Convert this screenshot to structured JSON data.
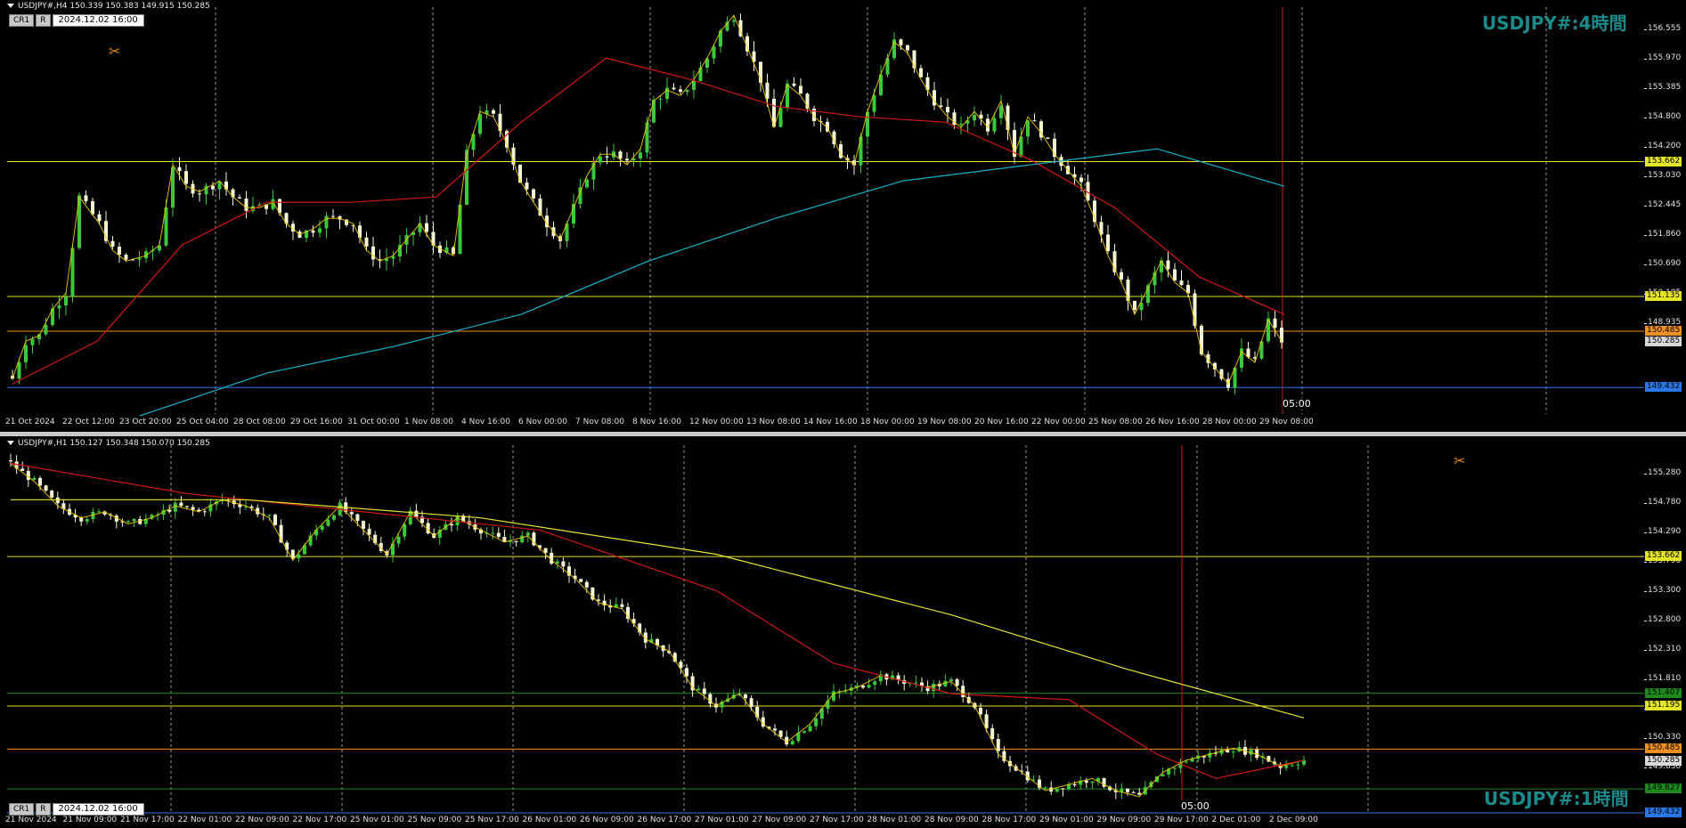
{
  "colors": {
    "background": "#000000",
    "bull_candle": "#3cc83c",
    "bear_candle": "#f5f5d2",
    "ma_red": "#d01818",
    "ma_cyan": "#14b4c8",
    "ma_yellow": "#e6e632",
    "zigzag": "#f0c800",
    "line_yellow": "#e6e628",
    "line_orange": "#f09020",
    "line_blue": "#2a78e6",
    "line_green": "#1e8a1e",
    "title": "#1c8a8a"
  },
  "top_pane": {
    "symbol_info": "USDJPY#,H4  150.339 150.383 149.915 150.285",
    "cr_label": "CR1",
    "r_label": "R",
    "datetime": "2024.12.02 16:00",
    "title": "USDJPY#:4時間",
    "marker_icon": "scissors-icon",
    "vline_label": "05:00",
    "price_labels": [
      "156.555",
      "155.970",
      "155.385",
      "154.800",
      "154.200",
      "153.030",
      "152.445",
      "151.860",
      "150.690",
      "150.105",
      "148.935"
    ],
    "price_tags": [
      {
        "text": "153.662",
        "bg": "#e6e628"
      },
      {
        "text": "151.135",
        "bg": "#e6e628"
      },
      {
        "text": "150.485",
        "bg": "#f09020"
      },
      {
        "text": "150.285",
        "bg": "#d8d8d8"
      },
      {
        "text": "149.432",
        "bg": "#2a78e6"
      }
    ],
    "time_labels": [
      "21 Oct 2024",
      "22 Oct 12:00",
      "23 Oct 20:00",
      "25 Oct 04:00",
      "28 Oct 08:00",
      "29 Oct 16:00",
      "31 Oct 00:00",
      "1 Nov 08:00",
      "4 Nov 16:00",
      "6 Nov 00:00",
      "7 Nov 08:00",
      "8 Nov 16:00",
      "12 Nov 00:00",
      "13 Nov 08:00",
      "14 Nov 16:00",
      "18 Nov 00:00",
      "19 Nov 08:00",
      "20 Nov 16:00",
      "22 Nov 00:00",
      "25 Nov 08:00",
      "26 Nov 16:00",
      "28 Nov 00:00",
      "29 Nov 08:00"
    ]
  },
  "bottom_pane": {
    "symbol_info": "USDJPY#,H1  150.127 150.348 150.070 150.285",
    "cr_label": "CR1",
    "r_label": "R",
    "datetime": "2024.12.02 16:00",
    "title": "USDJPY#:1時間",
    "marker_icon": "scissors-icon",
    "vline_label": "05:00",
    "price_labels": [
      "155.280",
      "154.780",
      "154.290",
      "153.790",
      "153.300",
      "152.800",
      "152.310",
      "151.810",
      "150.820",
      "150.330",
      "149.830"
    ],
    "price_tags": [
      {
        "text": "153.662",
        "bg": "#e6e628"
      },
      {
        "text": "151.407",
        "bg": "#1e8a1e"
      },
      {
        "text": "151.195",
        "bg": "#e6e628"
      },
      {
        "text": "150.485",
        "bg": "#f09020"
      },
      {
        "text": "150.285",
        "bg": "#d8d8d8"
      },
      {
        "text": "149.827",
        "bg": "#1e8a1e"
      },
      {
        "text": "149.432",
        "bg": "#2a78e6"
      }
    ],
    "time_labels": [
      "21 Nov 2024",
      "21 Nov 09:00",
      "21 Nov 17:00",
      "22 Nov 01:00",
      "22 Nov 09:00",
      "22 Nov 17:00",
      "25 Nov 01:00",
      "25 Nov 09:00",
      "25 Nov 17:00",
      "26 Nov 01:00",
      "26 Nov 09:00",
      "26 Nov 17:00",
      "27 Nov 01:00",
      "27 Nov 09:00",
      "27 Nov 17:00",
      "28 Nov 01:00",
      "28 Nov 09:00",
      "28 Nov 17:00",
      "29 Nov 01:00",
      "29 Nov 09:00",
      "29 Nov 17:00",
      "2 Dec 01:00",
      "2 Dec 09:00"
    ]
  },
  "chart_data": [
    {
      "type": "candlestick",
      "title": "USDJPY#:4時間",
      "timeframe": "H4",
      "ylim": [
        148.935,
        156.555
      ],
      "horizontal_lines": [
        153.662,
        151.135,
        150.485,
        149.432
      ],
      "close_price": 150.285,
      "close_path": [
        [
          0,
          149.6
        ],
        [
          2,
          150.3
        ],
        [
          4,
          150.4
        ],
        [
          6,
          150.9
        ],
        [
          8,
          151.2
        ],
        [
          10,
          153.0
        ],
        [
          13,
          152.5
        ],
        [
          15,
          152.0
        ],
        [
          17,
          151.8
        ],
        [
          20,
          151.9
        ],
        [
          22,
          152.1
        ],
        [
          24,
          153.6
        ],
        [
          26,
          153.2
        ],
        [
          28,
          153.1
        ],
        [
          31,
          153.3
        ],
        [
          33,
          153.0
        ],
        [
          35,
          152.8
        ],
        [
          37,
          152.8
        ],
        [
          39,
          152.9
        ],
        [
          41,
          152.5
        ],
        [
          43,
          152.3
        ],
        [
          45,
          152.4
        ],
        [
          47,
          152.6
        ],
        [
          49,
          152.6
        ],
        [
          51,
          152.5
        ],
        [
          53,
          152.0
        ],
        [
          55,
          151.8
        ],
        [
          57,
          151.9
        ],
        [
          59,
          152.2
        ],
        [
          61,
          152.5
        ],
        [
          63,
          152.1
        ],
        [
          66,
          151.9
        ],
        [
          68,
          153.8
        ],
        [
          70,
          154.6
        ],
        [
          72,
          154.5
        ],
        [
          74,
          154.0
        ],
        [
          76,
          153.3
        ],
        [
          78,
          152.9
        ],
        [
          80,
          152.5
        ],
        [
          82,
          152.2
        ],
        [
          84,
          152.8
        ],
        [
          86,
          153.4
        ],
        [
          88,
          153.8
        ],
        [
          90,
          153.8
        ],
        [
          92,
          153.6
        ],
        [
          94,
          153.9
        ],
        [
          96,
          154.8
        ],
        [
          98,
          155.0
        ],
        [
          100,
          154.9
        ],
        [
          102,
          155.2
        ],
        [
          104,
          155.6
        ],
        [
          106,
          156.1
        ],
        [
          108,
          156.4
        ],
        [
          110,
          155.8
        ],
        [
          112,
          155.2
        ],
        [
          114,
          154.3
        ],
        [
          116,
          155.1
        ],
        [
          118,
          154.9
        ],
        [
          120,
          154.5
        ],
        [
          122,
          154.3
        ],
        [
          124,
          153.8
        ],
        [
          126,
          153.6
        ],
        [
          128,
          154.6
        ],
        [
          130,
          155.3
        ],
        [
          132,
          155.9
        ],
        [
          134,
          155.7
        ],
        [
          136,
          155.2
        ],
        [
          138,
          154.8
        ],
        [
          140,
          154.5
        ],
        [
          142,
          154.3
        ],
        [
          144,
          154.6
        ],
        [
          146,
          154.3
        ],
        [
          148,
          154.8
        ],
        [
          150,
          153.8
        ],
        [
          152,
          154.5
        ],
        [
          154,
          154.2
        ],
        [
          156,
          153.8
        ],
        [
          158,
          153.5
        ],
        [
          160,
          153.2
        ],
        [
          162,
          152.6
        ],
        [
          164,
          151.9
        ],
        [
          166,
          151.4
        ],
        [
          168,
          150.8
        ],
        [
          170,
          151.3
        ],
        [
          172,
          151.8
        ],
        [
          174,
          151.4
        ],
        [
          176,
          151.2
        ],
        [
          178,
          150.1
        ],
        [
          180,
          149.8
        ],
        [
          182,
          149.5
        ],
        [
          184,
          150.1
        ],
        [
          186,
          149.9
        ],
        [
          188,
          150.7
        ],
        [
          190,
          150.3
        ]
      ],
      "ma_red": [
        [
          0,
          149.5
        ],
        [
          20,
          150.3
        ],
        [
          40,
          152.1
        ],
        [
          60,
          152.9
        ],
        [
          80,
          152.9
        ],
        [
          100,
          153.0
        ],
        [
          120,
          154.4
        ],
        [
          140,
          155.6
        ],
        [
          160,
          155.2
        ],
        [
          180,
          154.7
        ],
        [
          200,
          154.5
        ],
        [
          220,
          154.4
        ],
        [
          240,
          153.7
        ],
        [
          260,
          152.8
        ],
        [
          280,
          151.5
        ],
        [
          300,
          150.8
        ]
      ],
      "ma_cyan": [
        [
          30,
          148.9
        ],
        [
          60,
          149.7
        ],
        [
          90,
          150.2
        ],
        [
          120,
          150.8
        ],
        [
          150,
          151.8
        ],
        [
          180,
          152.6
        ],
        [
          210,
          153.3
        ],
        [
          240,
          153.6
        ],
        [
          270,
          153.9
        ],
        [
          300,
          153.2
        ]
      ]
    },
    {
      "type": "candlestick",
      "title": "USDJPY#:1時間",
      "timeframe": "H1",
      "ylim": [
        149.432,
        155.5
      ],
      "horizontal_lines": [
        153.662,
        151.407,
        151.195,
        150.485,
        149.827,
        149.432
      ],
      "close_price": 150.285,
      "close_path": [
        [
          0,
          155.2
        ],
        [
          4,
          154.9
        ],
        [
          8,
          154.5
        ],
        [
          12,
          154.3
        ],
        [
          16,
          154.4
        ],
        [
          20,
          154.2
        ],
        [
          24,
          154.3
        ],
        [
          28,
          154.5
        ],
        [
          32,
          154.4
        ],
        [
          36,
          154.6
        ],
        [
          40,
          154.5
        ],
        [
          44,
          154.3
        ],
        [
          48,
          153.6
        ],
        [
          52,
          154.1
        ],
        [
          56,
          154.5
        ],
        [
          60,
          154.1
        ],
        [
          64,
          153.7
        ],
        [
          68,
          154.4
        ],
        [
          72,
          154.0
        ],
        [
          76,
          154.3
        ],
        [
          80,
          154.1
        ],
        [
          84,
          153.9
        ],
        [
          88,
          154.0
        ],
        [
          92,
          153.6
        ],
        [
          96,
          153.3
        ],
        [
          100,
          152.9
        ],
        [
          104,
          152.8
        ],
        [
          108,
          152.3
        ],
        [
          112,
          152.1
        ],
        [
          116,
          151.5
        ],
        [
          120,
          151.2
        ],
        [
          124,
          151.4
        ],
        [
          128,
          150.9
        ],
        [
          132,
          150.6
        ],
        [
          136,
          150.9
        ],
        [
          140,
          151.4
        ],
        [
          144,
          151.5
        ],
        [
          148,
          151.7
        ],
        [
          152,
          151.6
        ],
        [
          156,
          151.5
        ],
        [
          160,
          151.6
        ],
        [
          164,
          151.2
        ],
        [
          168,
          150.4
        ],
        [
          172,
          150.1
        ],
        [
          176,
          149.8
        ],
        [
          180,
          149.9
        ],
        [
          184,
          150.0
        ],
        [
          188,
          149.8
        ],
        [
          192,
          149.7
        ],
        [
          196,
          150.1
        ],
        [
          200,
          150.3
        ],
        [
          204,
          150.4
        ],
        [
          208,
          150.5
        ],
        [
          212,
          150.4
        ],
        [
          216,
          150.2
        ],
        [
          220,
          150.3
        ]
      ],
      "ma_red": [
        [
          0,
          155.2
        ],
        [
          30,
          154.7
        ],
        [
          60,
          154.4
        ],
        [
          90,
          154.1
        ],
        [
          120,
          153.1
        ],
        [
          140,
          151.9
        ],
        [
          160,
          151.4
        ],
        [
          180,
          151.3
        ],
        [
          195,
          150.4
        ],
        [
          205,
          150.0
        ],
        [
          220,
          150.3
        ]
      ],
      "ma_yellow": [
        [
          0,
          154.6
        ],
        [
          40,
          154.6
        ],
        [
          80,
          154.3
        ],
        [
          120,
          153.7
        ],
        [
          160,
          152.7
        ],
        [
          190,
          151.8
        ],
        [
          220,
          151.0
        ]
      ]
    }
  ]
}
